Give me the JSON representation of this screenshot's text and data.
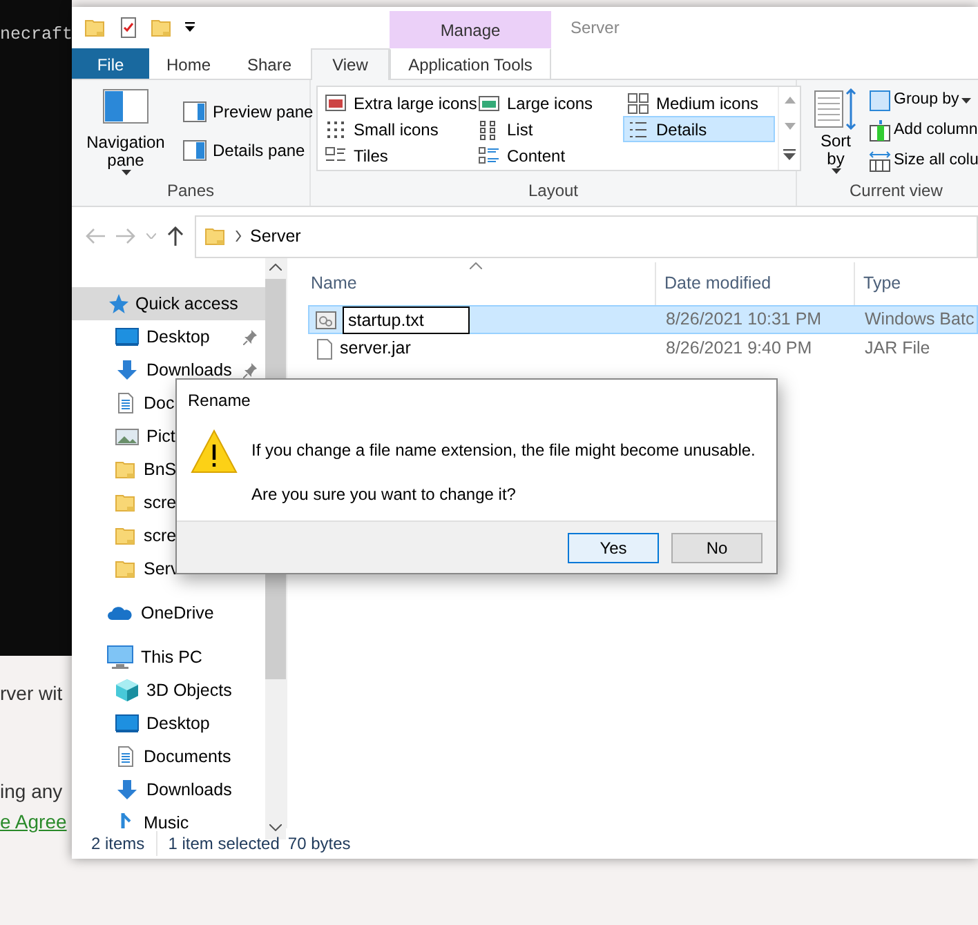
{
  "background": {
    "terminal_text": "necraft",
    "page_lines": [
      {
        "text": "rver wit",
        "kind": "text"
      },
      {
        "text": "ing any",
        "kind": "text"
      },
      {
        "text": "e Agree",
        "kind": "link"
      }
    ]
  },
  "explorer": {
    "title": "Server",
    "context_group": "Manage",
    "tabs": [
      {
        "label": "File",
        "kind": "file",
        "selected": false
      },
      {
        "label": "Home",
        "kind": "tab",
        "selected": false
      },
      {
        "label": "Share",
        "kind": "tab",
        "selected": false
      },
      {
        "label": "View",
        "kind": "tab",
        "selected": true
      },
      {
        "label": "Application Tools",
        "kind": "context",
        "selected": false
      }
    ],
    "panes_group": {
      "label": "Panes",
      "navigation_button": "Navigation pane",
      "buttons": [
        "Preview pane",
        "Details pane"
      ]
    },
    "layout_group": {
      "label": "Layout",
      "options": [
        {
          "label": "Extra large icons",
          "kind": "xl",
          "selected": false
        },
        {
          "label": "Large icons",
          "kind": "large",
          "selected": false
        },
        {
          "label": "Medium icons",
          "kind": "medium",
          "selected": false
        },
        {
          "label": "Small icons",
          "kind": "small",
          "selected": false
        },
        {
          "label": "List",
          "kind": "list",
          "selected": false
        },
        {
          "label": "Details",
          "kind": "details",
          "selected": true
        },
        {
          "label": "Tiles",
          "kind": "tiles",
          "selected": false
        },
        {
          "label": "Content",
          "kind": "content",
          "selected": false
        }
      ]
    },
    "current_view_group": {
      "label": "Current view",
      "sort_button": "Sort by",
      "options": [
        {
          "label": "Group by",
          "kind": "group"
        },
        {
          "label": "Add column",
          "kind": "add"
        },
        {
          "label": "Size all colu",
          "kind": "size"
        }
      ]
    },
    "address": {
      "path": [
        "Server"
      ]
    },
    "nav_pane": {
      "items": [
        {
          "label": "Quick access",
          "kind": "star",
          "selected": true,
          "children": [
            {
              "label": "Desktop",
              "kind": "desktop",
              "selected": false,
              "pinned": true
            },
            {
              "label": "Downloads",
              "kind": "download",
              "selected": false,
              "pinned": true
            },
            {
              "label": "Doc",
              "kind": "document",
              "selected": false,
              "pinned": false
            },
            {
              "label": "Pict",
              "kind": "picture",
              "selected": false,
              "pinned": false
            },
            {
              "label": "BnS",
              "kind": "folder",
              "selected": false,
              "pinned": false
            },
            {
              "label": "scre",
              "kind": "folder",
              "selected": false,
              "pinned": false
            },
            {
              "label": "scre",
              "kind": "folder",
              "selected": false,
              "pinned": false
            },
            {
              "label": "Serv",
              "kind": "folder",
              "selected": false,
              "pinned": false
            }
          ]
        },
        {
          "label": "OneDrive",
          "kind": "cloud",
          "selected": false
        },
        {
          "label": "This PC",
          "kind": "pc",
          "selected": false,
          "children": [
            {
              "label": "3D Objects",
              "kind": "cube",
              "selected": false
            },
            {
              "label": "Desktop",
              "kind": "desktop",
              "selected": false
            },
            {
              "label": "Documents",
              "kind": "document",
              "selected": false
            },
            {
              "label": "Downloads",
              "kind": "download",
              "selected": false
            },
            {
              "label": "Music",
              "kind": "music",
              "selected": false
            }
          ]
        }
      ]
    },
    "file_list": {
      "columns": [
        {
          "label": "Name",
          "sorted": true
        },
        {
          "label": "Date modified",
          "sorted": false
        },
        {
          "label": "Type",
          "sorted": false
        }
      ],
      "rows": [
        {
          "name": "startup.txt",
          "date": "8/26/2021 10:31 PM",
          "type": "Windows Batc",
          "kind": "batch",
          "selected": true,
          "renaming": true
        },
        {
          "name": "server.jar",
          "date": "8/26/2021 9:40 PM",
          "type": "JAR File",
          "kind": "file",
          "selected": false,
          "renaming": false
        }
      ]
    },
    "status_bar": [
      "2 items",
      "1 item selected",
      "70 bytes"
    ]
  },
  "dialog": {
    "title": "Rename",
    "message": "If you change a file name extension, the file might become unusable.",
    "question": "Are you sure you want to change it?",
    "buttons": [
      {
        "label": "Yes",
        "default": true
      },
      {
        "label": "No",
        "default": false
      }
    ]
  }
}
